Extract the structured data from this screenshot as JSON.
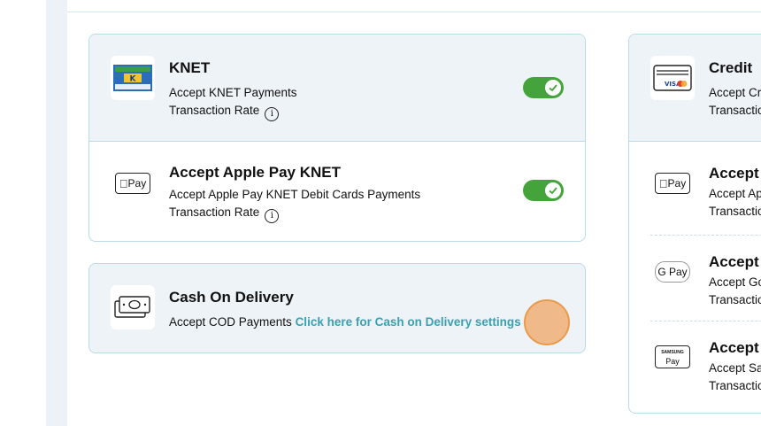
{
  "knet_card": {
    "knet": {
      "title": "KNET",
      "description": "Accept KNET Payments",
      "rate_label": "Transaction Rate",
      "enabled": true
    },
    "apple_pay_knet": {
      "title": "Accept  Apple Pay KNET",
      "description": "Accept Apple Pay KNET Debit Cards Payments",
      "rate_label": "Transaction Rate",
      "enabled": true
    }
  },
  "cod_card": {
    "title": "Cash On Delivery",
    "description": "Accept COD Payments",
    "link_text": "Click here for Cash on Delivery settings"
  },
  "credit_card": {
    "title": "Credit",
    "description": "Accept Cr",
    "rate_label": "Transactio",
    "apple_pay": {
      "title": "Accept A",
      "description": "Accept Ap",
      "rate_label": "Transactio",
      "badge": "Pay"
    },
    "google_pay": {
      "title": "Accept ",
      "description": "Accept Go",
      "rate_label": "Transactio",
      "badge": "G Pay"
    },
    "samsung_pay": {
      "title": "Accept S",
      "description": "Accept Sa",
      "rate_label": "Transactio",
      "badge_top": "SAMSUNG",
      "badge_bottom": "Pay"
    }
  },
  "badges": {
    "apple_pay": "Pay",
    "visa": "VISA",
    "knet_logo_text": "K"
  },
  "colors": {
    "accent_link": "#3aa0b0",
    "toggle_on": "#44a33a",
    "card_tint": "#eef3f8",
    "card_border": "#b9dbe6"
  }
}
